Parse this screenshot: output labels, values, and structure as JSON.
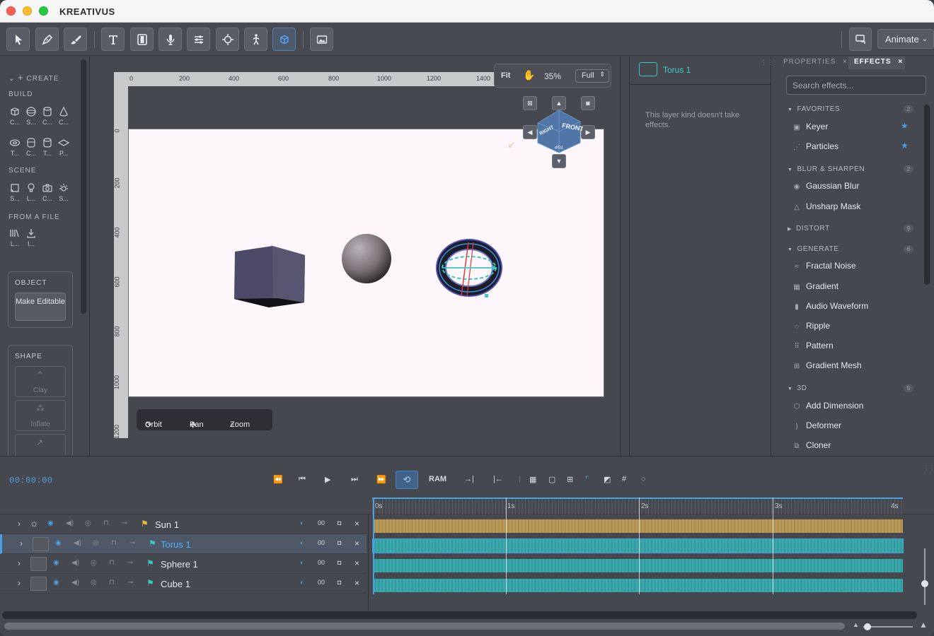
{
  "app": {
    "title": "KREATIVUS"
  },
  "toolbar": {
    "animate_label": "Animate"
  },
  "left_panel": {
    "create_label": "CREATE",
    "build_label": "BUILD",
    "build_items": [
      "C...",
      "S...",
      "C...",
      "C...",
      "T...",
      "C...",
      "T...",
      "P..."
    ],
    "scene_label": "SCENE",
    "scene_items": [
      "S...",
      "L...",
      "C...",
      "S..."
    ],
    "file_label": "FROM A FILE",
    "file_items": [
      "L...",
      "I..."
    ],
    "object_label": "OBJECT",
    "make_editable": "Make Editable",
    "shape_label": "SHAPE",
    "shape_items": [
      "Clay",
      "Inflate"
    ]
  },
  "viewport": {
    "fit_label": "Fit",
    "zoom_value": "35%",
    "quality": "Full",
    "ruler_h": [
      "0",
      "200",
      "400",
      "600",
      "800",
      "1000",
      "1200",
      "1400"
    ],
    "ruler_v": [
      "0",
      "200",
      "400",
      "600",
      "800",
      "1000",
      "1200"
    ],
    "nav_cube": {
      "front": "FRONT",
      "right": "RIGHT",
      "bottom": "TOP"
    },
    "controls": {
      "orbit": "Orbit",
      "pan": "Pan",
      "zoom": "Zoom"
    }
  },
  "info_panel": {
    "layer_name": "Torus 1",
    "message": "This layer kind doesn't take effects."
  },
  "effects_panel": {
    "tab_properties": "PROPERTIES",
    "tab_effects": "EFFECTS",
    "search_placeholder": "Search effects...",
    "categories": [
      {
        "name": "FAVORITES",
        "count": "2",
        "items": [
          "Keyer",
          "Particles"
        ]
      },
      {
        "name": "BLUR & SHARPEN",
        "count": "2",
        "items": [
          "Gaussian Blur",
          "Unsharp Mask"
        ]
      },
      {
        "name": "DISTORT",
        "count": "9",
        "items": []
      },
      {
        "name": "GENERATE",
        "count": "6",
        "items": [
          "Fractal Noise",
          "Gradient",
          "Audio Waveform",
          "Ripple",
          "Pattern",
          "Gradient Mesh"
        ]
      },
      {
        "name": "3D",
        "count": "5",
        "items": [
          "Add Dimension",
          "Deformer",
          "Cloner"
        ]
      }
    ]
  },
  "timeline": {
    "timecode": "00:00:00",
    "ram_label": "RAM",
    "ruler": [
      "0s",
      "1s",
      "2s",
      "3s",
      "4s"
    ],
    "layers": [
      {
        "name": "Sun 1",
        "color": "#c9a53c"
      },
      {
        "name": "Torus 1",
        "color": "#3bb3b7"
      },
      {
        "name": "Sphere 1",
        "color": "#3bb3b7"
      },
      {
        "name": "Cube 1",
        "color": "#3bb3b7"
      }
    ],
    "cell_values": [
      "00",
      "00",
      "00",
      "00"
    ]
  }
}
